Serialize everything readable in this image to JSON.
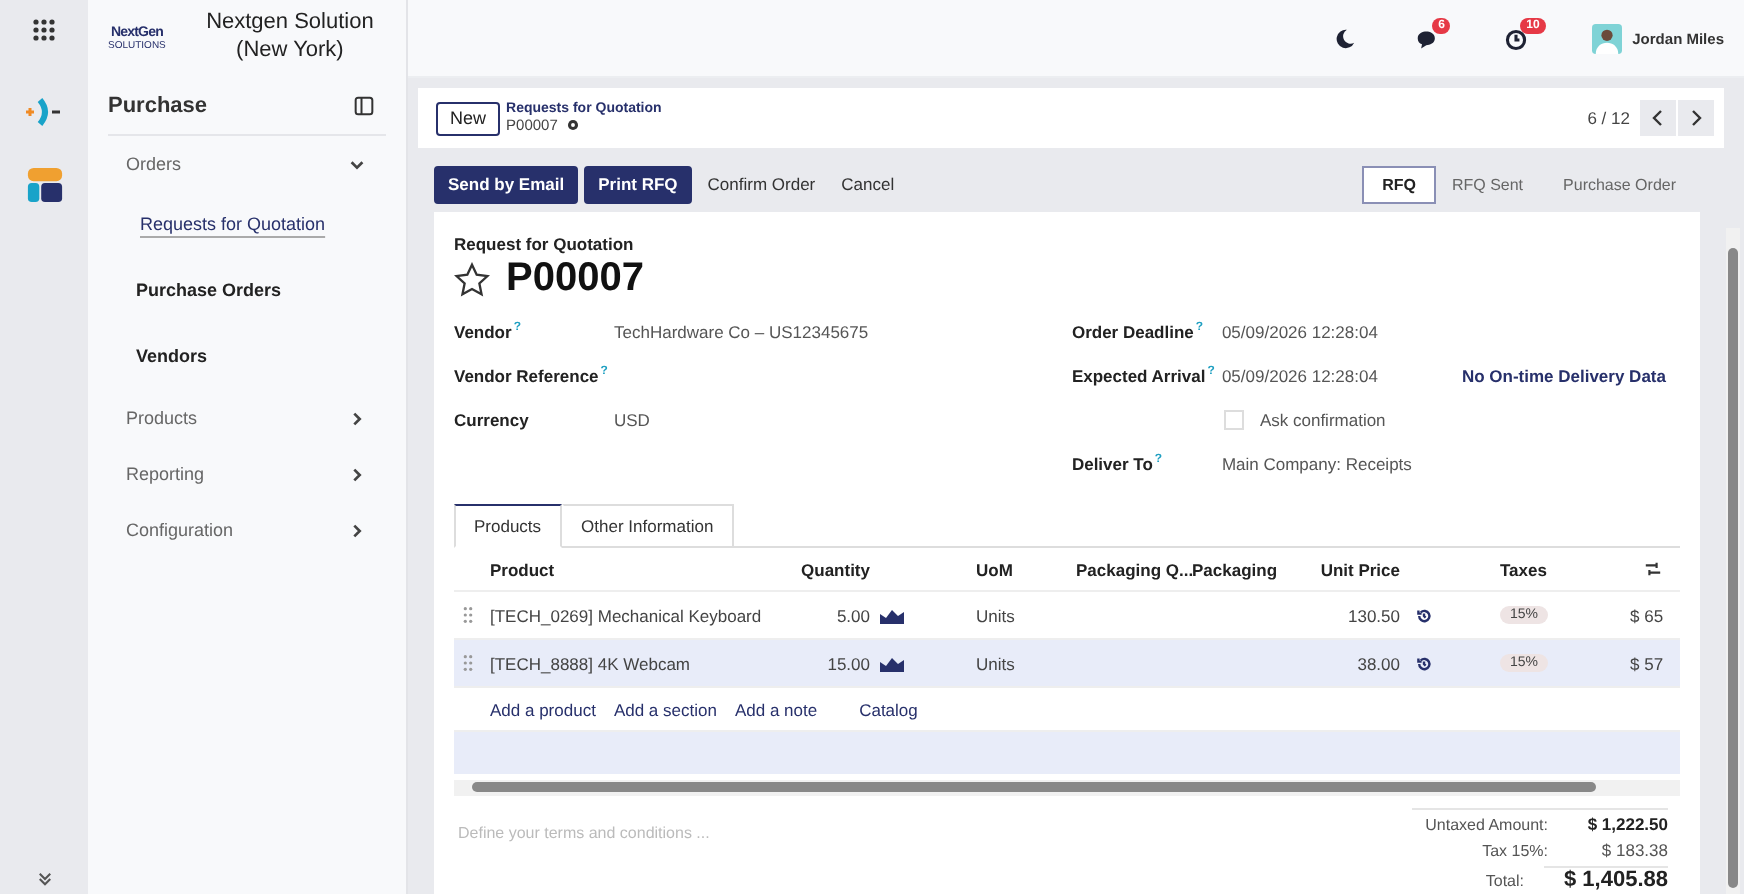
{
  "company": {
    "logo_text": "NextGen",
    "logo_subtext": "SOLUTIONS",
    "name": "Nextgen Solution (New York)"
  },
  "topbar": {
    "chat_badge": "6",
    "activity_badge": "10",
    "user": "Jordan Miles"
  },
  "sidebar": {
    "title": "Purchase",
    "items": [
      {
        "label": "Orders",
        "expanded": true,
        "children": [
          {
            "label": "Requests for Quotation",
            "selected": true
          },
          {
            "label": "Purchase Orders",
            "selected": false
          },
          {
            "label": "Vendors",
            "selected": false
          }
        ]
      },
      {
        "label": "Products",
        "expanded": false
      },
      {
        "label": "Reporting",
        "expanded": false
      },
      {
        "label": "Configuration",
        "expanded": false
      }
    ]
  },
  "control_panel": {
    "new_button": "New",
    "breadcrumb": "Requests for Quotation",
    "record": "P00007",
    "pager": "6 / 12"
  },
  "actions": [
    {
      "label": "Send by Email",
      "kind": "primary"
    },
    {
      "label": "Print RFQ",
      "kind": "primary"
    },
    {
      "label": "Confirm Order",
      "kind": "secondary"
    },
    {
      "label": "Cancel",
      "kind": "secondary"
    }
  ],
  "status_bar": [
    {
      "label": "RFQ",
      "selected": true
    },
    {
      "label": "RFQ Sent",
      "selected": false
    },
    {
      "label": "Purchase Order",
      "selected": false
    }
  ],
  "form": {
    "subtitle": "Request for Quotation",
    "title": "P00007",
    "starred": false,
    "left_fields": [
      {
        "label": "Vendor",
        "help": "?",
        "value": "TechHardware Co – US12345675"
      },
      {
        "label": "Vendor Reference",
        "help": "?"
      },
      {
        "label": "Currency",
        "value": "USD"
      }
    ],
    "right_fields": [
      {
        "kind": "text",
        "label": "Order Deadline",
        "help": "?",
        "value": "05/09/2026 12:28:04"
      },
      {
        "kind": "text",
        "label": "Expected Arrival",
        "help": "?",
        "value": "05/09/2026 12:28:04",
        "note": "No On-time Delivery Data"
      },
      {
        "kind": "checkbox",
        "label": "Ask confirmation",
        "checked": false
      },
      {
        "kind": "text",
        "label": "Deliver To",
        "help": "?",
        "value": "Main Company: Receipts"
      }
    ]
  },
  "tabs": [
    {
      "label": "Products",
      "selected": true
    },
    {
      "label": "Other Information",
      "selected": false
    }
  ],
  "table": {
    "columns": [
      "Product",
      "Quantity",
      "UoM",
      "Packaging Q...",
      "Packaging",
      "Unit Price",
      "Taxes"
    ],
    "rows": [
      {
        "product": "[TECH_0269] Mechanical Keyboard",
        "quantity": "5.00",
        "uom": "Units",
        "unit_price": "130.50",
        "tax": "15%",
        "column_10": "$ 65",
        "selected": false
      },
      {
        "product": "[TECH_8888] 4K Webcam",
        "quantity": "15.00",
        "uom": "Units",
        "unit_price": "38.00",
        "tax": "15%",
        "column_10": "$ 57",
        "selected": true
      }
    ],
    "add_links": [
      "Add a product",
      "Add a section",
      "Add a note",
      "Catalog"
    ]
  },
  "terms": {
    "placeholder": "Define your terms and conditions ..."
  },
  "totals": [
    {
      "label": "Untaxed Amount:",
      "value": "$ 1,222.50",
      "kind": "subtotal"
    },
    {
      "label": "Tax 15%:",
      "value": "$ 183.38",
      "kind": "tax"
    },
    {
      "label": "Total:",
      "value": "$ 1,405.88",
      "kind": "total"
    }
  ]
}
